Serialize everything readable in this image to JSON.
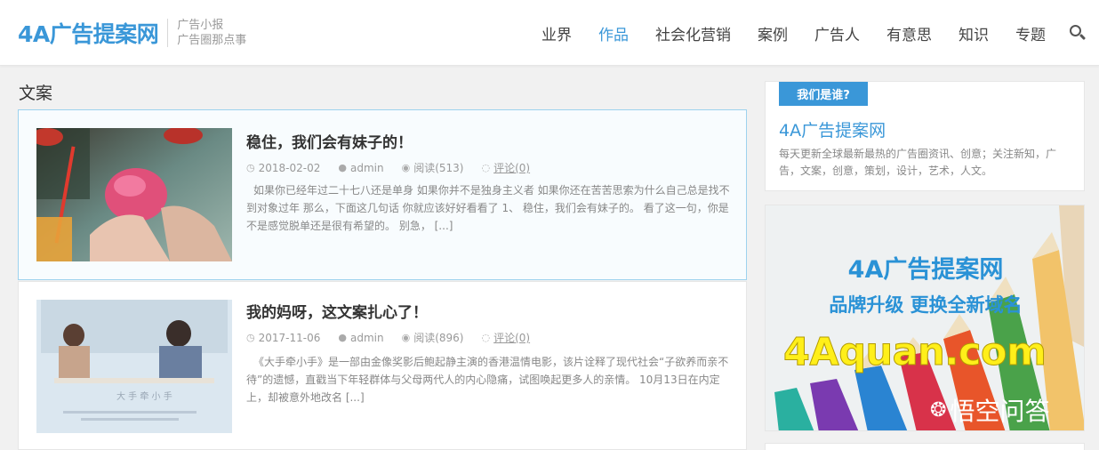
{
  "header": {
    "logo": "4A广告提案网",
    "tagline_line1": "广告小报",
    "tagline_line2": "广告圈那点事",
    "nav": [
      {
        "label": "业界",
        "active": false
      },
      {
        "label": "作品",
        "active": true
      },
      {
        "label": "社会化营销",
        "active": false
      },
      {
        "label": "案例",
        "active": false
      },
      {
        "label": "广告人",
        "active": false
      },
      {
        "label": "有意思",
        "active": false
      },
      {
        "label": "知识",
        "active": false
      },
      {
        "label": "专题",
        "active": false
      }
    ],
    "search_icon": "search-icon"
  },
  "main": {
    "heading": "文案",
    "posts": [
      {
        "title": "稳住，我们会有妹子的！",
        "date": "2018-02-02",
        "author": "admin",
        "views": "阅读(513)",
        "comments": "评论(0)",
        "excerpt": "如果你已经年过二十七八还是单身 如果你并不是独身主义者 如果你还在苦苦思索为什么自己总是找不到对象过年 那么，下面这几句话 你就应该好好看看了 1、 稳住，我们会有妹子的。 看了这一句，你是不是感觉脱单还是很有希望的。 别急， [...]"
      },
      {
        "title": "我的妈呀，这文案扎心了！",
        "date": "2017-11-06",
        "author": "admin",
        "views": "阅读(896)",
        "comments": "评论(0)",
        "excerpt": "《大手牵小手》是一部由金像奖影后鲍起静主演的香港温情电影，该片诠释了现代社会“子欲养而亲不待”的遗憾，直戳当下年轻群体与父母两代人的内心隐痛，试图唤起更多人的亲情。 10月13日在内定上，却被意外地改名 [...]"
      }
    ]
  },
  "sidebar": {
    "about_label": "我们是谁?",
    "about_title": "4A广告提案网",
    "about_desc": "每天更新全球最新最热的广告圈资讯、创意；关注新知，广告，文案，创意，策划，设计，艺术，人文。",
    "banner": {
      "line1": "4A广告提案网",
      "line2": "品牌升级  更换全新域名",
      "line3": "4Aquan.com",
      "watermark": "悟空问答"
    }
  },
  "colors": {
    "accent": "#3a97d8",
    "banner_yellow": "#ffef1a"
  }
}
